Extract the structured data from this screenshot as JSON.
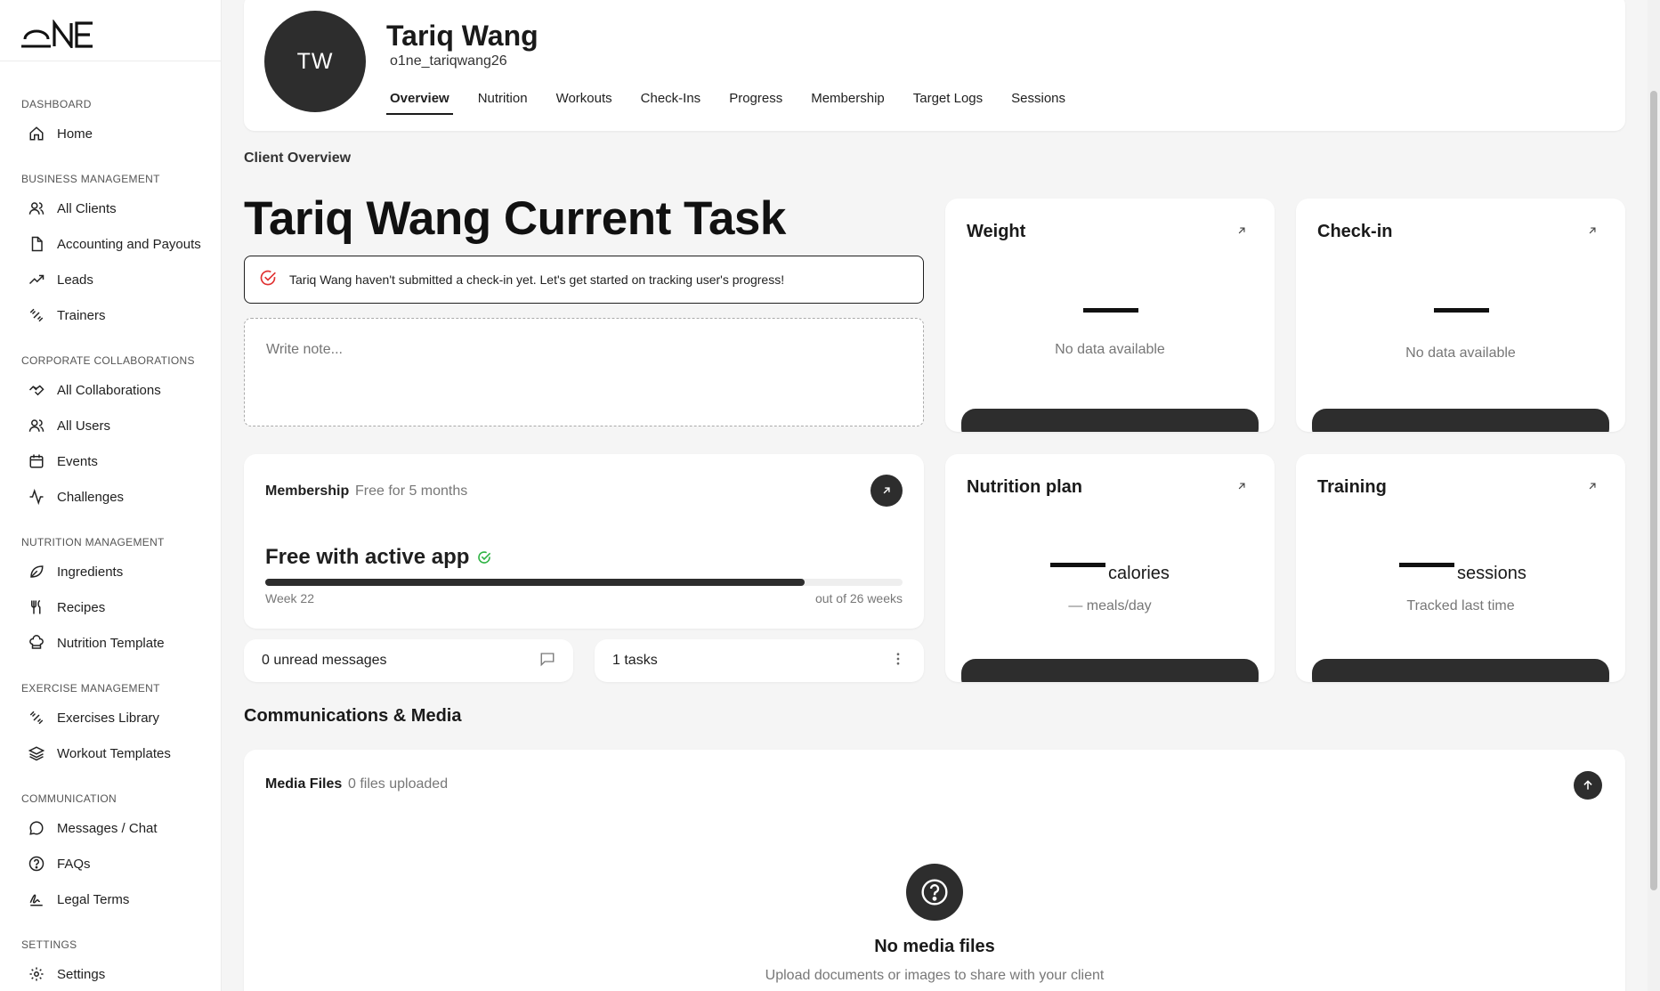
{
  "sidebar": {
    "logo": "ONE",
    "sections": [
      {
        "title": "DASHBOARD",
        "items": [
          {
            "label": "Home",
            "icon": "home-icon"
          }
        ]
      },
      {
        "title": "BUSINESS MANAGEMENT",
        "items": [
          {
            "label": "All Clients",
            "icon": "users-icon"
          },
          {
            "label": "Accounting and Payouts",
            "icon": "file-icon"
          },
          {
            "label": "Leads",
            "icon": "trending-up-icon"
          },
          {
            "label": "Trainers",
            "icon": "dumbbell-icon"
          }
        ]
      },
      {
        "title": "CORPORATE COLLABORATIONS",
        "items": [
          {
            "label": "All Collaborations",
            "icon": "handshake-icon"
          },
          {
            "label": "All Users",
            "icon": "users-icon"
          },
          {
            "label": "Events",
            "icon": "calendar-icon"
          },
          {
            "label": "Challenges",
            "icon": "activity-icon"
          }
        ]
      },
      {
        "title": "NUTRITION MANAGEMENT",
        "items": [
          {
            "label": "Ingredients",
            "icon": "leaf-icon"
          },
          {
            "label": "Recipes",
            "icon": "utensils-icon"
          },
          {
            "label": "Nutrition Template",
            "icon": "chef-hat-icon"
          }
        ]
      },
      {
        "title": "EXERCISE MANAGEMENT",
        "items": [
          {
            "label": "Exercises Library",
            "icon": "dumbbell-icon"
          },
          {
            "label": "Workout Templates",
            "icon": "layers-icon"
          }
        ]
      },
      {
        "title": "COMMUNICATION",
        "items": [
          {
            "label": "Messages / Chat",
            "icon": "message-circle-icon"
          },
          {
            "label": "FAQs",
            "icon": "help-circle-icon"
          },
          {
            "label": "Legal Terms",
            "icon": "signature-icon"
          }
        ]
      },
      {
        "title": "SETTINGS",
        "items": [
          {
            "label": "Settings",
            "icon": "gear-icon"
          }
        ]
      }
    ]
  },
  "client": {
    "initials": "TW",
    "name": "Tariq Wang",
    "handle": "o1ne_tariqwang26"
  },
  "tabs": [
    "Overview",
    "Nutrition",
    "Workouts",
    "Check-Ins",
    "Progress",
    "Membership",
    "Target Logs",
    "Sessions"
  ],
  "active_tab": "Overview",
  "overview": {
    "section_label": "Client Overview",
    "task_title": "Tariq Wang Current Task",
    "alert_text": "Tariq Wang haven't submitted a check-in yet. Let's get started on tracking user's progress!",
    "note_placeholder": "Write note..."
  },
  "membership": {
    "label": "Membership",
    "subtitle": "Free for 5 months",
    "plan": "Free with active app",
    "progress_fraction": 0.846,
    "week_left": "Week 22",
    "week_right": "out of 26 weeks"
  },
  "mini": {
    "messages": "0 unread messages",
    "tasks": "1 tasks"
  },
  "stats": {
    "weight": {
      "title": "Weight",
      "value_text": "No data available"
    },
    "checkin": {
      "title": "Check-in",
      "value_text": "No data available"
    },
    "nutrition": {
      "title": "Nutrition plan",
      "unit": "calories",
      "sub": "— meals/day"
    },
    "training": {
      "title": "Training",
      "unit": "sessions",
      "sub": "Tracked last time"
    }
  },
  "communications": {
    "title": "Communications & Media",
    "media_label": "Media Files",
    "media_sub": "0 files uploaded",
    "empty_title": "No media files",
    "empty_sub": "Upload documents or images to share with your client"
  },
  "colors": {
    "dark": "#2d2d2d",
    "alert_icon": "#e03131",
    "check_icon": "#2fb344"
  }
}
